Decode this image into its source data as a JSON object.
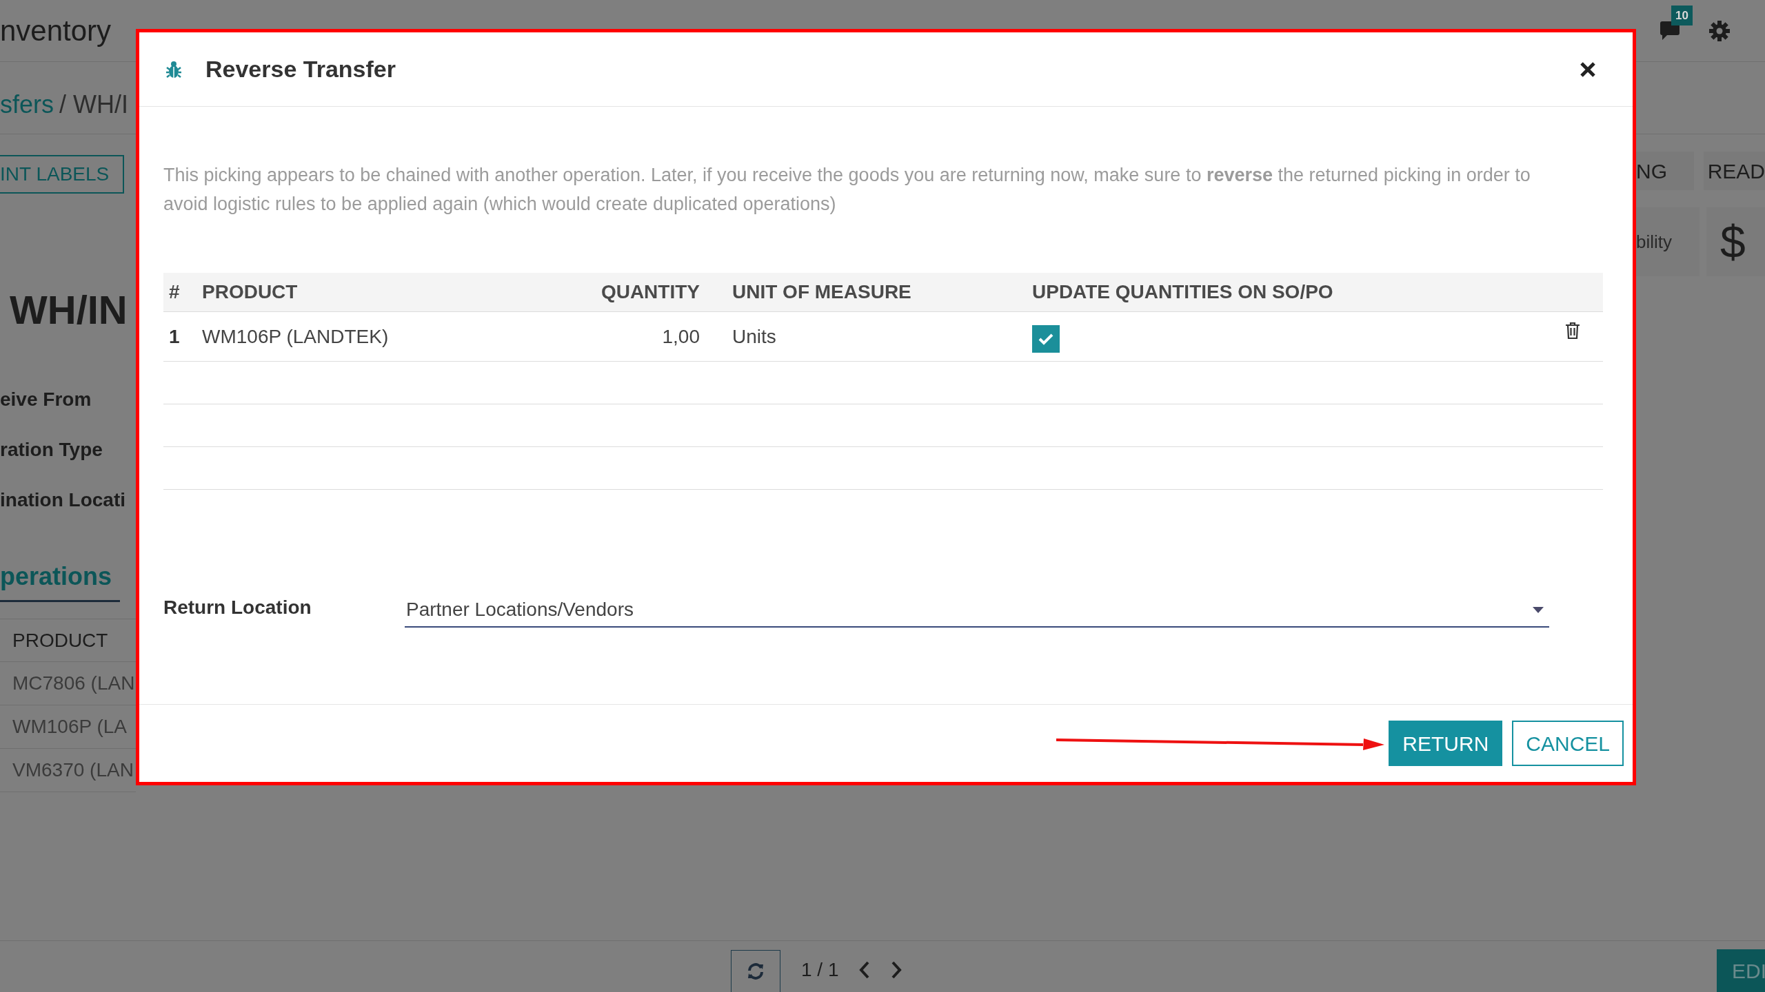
{
  "app_bar": {
    "app_name": "nventory",
    "message_count": "10"
  },
  "breadcrumb": {
    "parent": "sfers",
    "current": "/ WH/I"
  },
  "background": {
    "print_button": "INT LABELS",
    "record_title": "WH/IN",
    "fields": [
      "eive From",
      "ration Type",
      "ination Locati"
    ],
    "tab": "perations",
    "column": "PRODUCT",
    "rows": [
      "MC7806 (LAN",
      "WM106P (LA",
      "VM6370 (LAN"
    ],
    "right_buttons": [
      "NG",
      "READ"
    ],
    "stat_label": "bility",
    "stat_symbol": "$",
    "pager": "1 / 1",
    "edit_button": "EDI"
  },
  "dialog": {
    "title": "Reverse Transfer",
    "message": "This picking appears to be chained with another operation. Later, if you receive the goods you are returning now, make sure to **reverse** the returned picking in order to avoid logistic rules to be applied again (which would create duplicated operations)",
    "columns": [
      "#",
      "PRODUCT",
      "QUANTITY",
      "UNIT OF MEASURE",
      "UPDATE QUANTITIES ON SO/PO"
    ],
    "rows": [
      {
        "index": "1",
        "product": "WM106P (LANDTEK)",
        "quantity": "1,00",
        "uom": "Units",
        "update_quantities": true
      }
    ],
    "return_location": {
      "label": "Return Location",
      "value": "Partner Locations/Vendors"
    },
    "buttons": [
      {
        "label": "RETURN",
        "kind": "primary"
      },
      {
        "label": "CANCEL",
        "kind": "secondary"
      }
    ]
  }
}
